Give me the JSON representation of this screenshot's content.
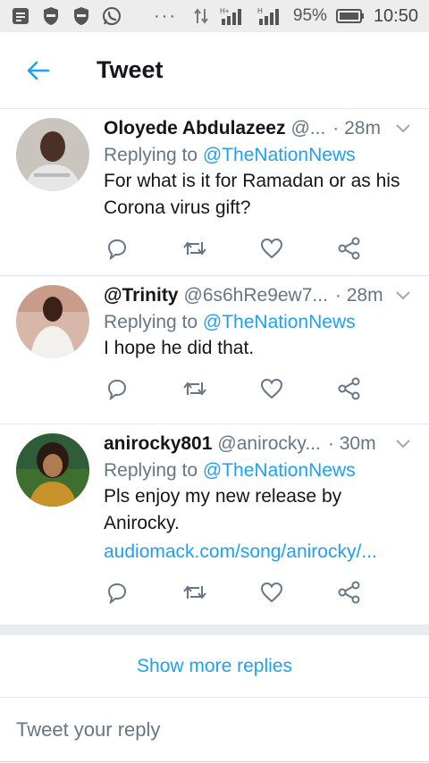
{
  "status_bar": {
    "battery": "95%",
    "time": "10:50",
    "network_label_1": "H+",
    "network_label_2": "H",
    "dots": "···"
  },
  "header": {
    "title": "Tweet"
  },
  "tweets": [
    {
      "name": "Oloyede Abdulazeez",
      "handle": "@...",
      "time": "· 28m",
      "replying_prefix": "Replying to ",
      "replying_to": "@TheNationNews",
      "text": "For what is it for Ramadan or as his Corona virus gift?",
      "link": ""
    },
    {
      "name": "@Trinity",
      "handle": "@6s6hRe9ew7...",
      "time": "· 28m",
      "replying_prefix": "Replying to ",
      "replying_to": "@TheNationNews",
      "text": "I hope he did that.",
      "link": ""
    },
    {
      "name": "anirocky801",
      "handle": "@anirocky...",
      "time": "· 30m",
      "replying_prefix": "Replying to ",
      "replying_to": "@TheNationNews",
      "text": "Pls enjoy my new release by Anirocky.",
      "link": "audiomack.com/song/anirocky/..."
    }
  ],
  "show_more": "Show more replies",
  "compose": {
    "placeholder": "Tweet your reply"
  },
  "colors": {
    "accent": "#1da1f2",
    "secondary_text": "#657786"
  }
}
